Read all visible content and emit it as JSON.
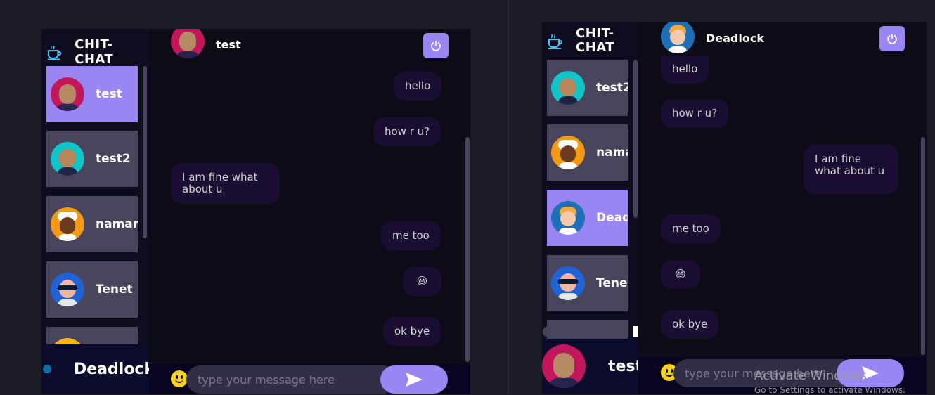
{
  "app_name": "CHIT-CHAT",
  "left": {
    "current_user": "Deadlock",
    "contacts": [
      {
        "name": "test",
        "avatar": "pink-hair-avatar"
      },
      {
        "name": "test2",
        "avatar": "teal-horned-avatar"
      },
      {
        "name": "naman",
        "avatar": "orange-white-hair-avatar"
      },
      {
        "name": "Tenet",
        "avatar": "blue-visor-avatar"
      },
      {
        "name": "",
        "avatar": "yellow-avatar"
      }
    ],
    "chat_with": "test",
    "messages": [
      {
        "text": "hello",
        "side": "sent"
      },
      {
        "text": "how r u?",
        "side": "sent"
      },
      {
        "text": "I am fine what about u",
        "side": "received"
      },
      {
        "text": "me too",
        "side": "sent"
      },
      {
        "text": "😃",
        "side": "sent"
      },
      {
        "text": "ok bye",
        "side": "sent"
      }
    ],
    "input_placeholder": "type your message here"
  },
  "right": {
    "current_user": "test",
    "contacts": [
      {
        "name": "test2",
        "avatar": "teal-horned-avatar"
      },
      {
        "name": "naman",
        "avatar": "orange-white-hair-avatar"
      },
      {
        "name": "Deadlock",
        "avatar": "blonde-horned-avatar"
      },
      {
        "name": "Tenet",
        "avatar": "blue-visor-avatar"
      }
    ],
    "chat_with": "Deadlock",
    "messages": [
      {
        "text": "hello",
        "side": "received"
      },
      {
        "text": "how r u?",
        "side": "received"
      },
      {
        "text": "I am fine what about u",
        "side": "sent"
      },
      {
        "text": "me too",
        "side": "received"
      },
      {
        "text": "😃",
        "side": "received"
      },
      {
        "text": "ok bye",
        "side": "received"
      }
    ],
    "input_placeholder": "type your message here"
  },
  "watermark": {
    "title": "Activate Windows",
    "subtitle": "Go to Settings to activate Windows."
  },
  "colors": {
    "accent": "#9a86f3",
    "contact_bg": "#48445c",
    "bubble_bg": "#1a0f33",
    "sidebar_bg": "#0e0d1d",
    "chat_bg": "#0d0c16"
  }
}
